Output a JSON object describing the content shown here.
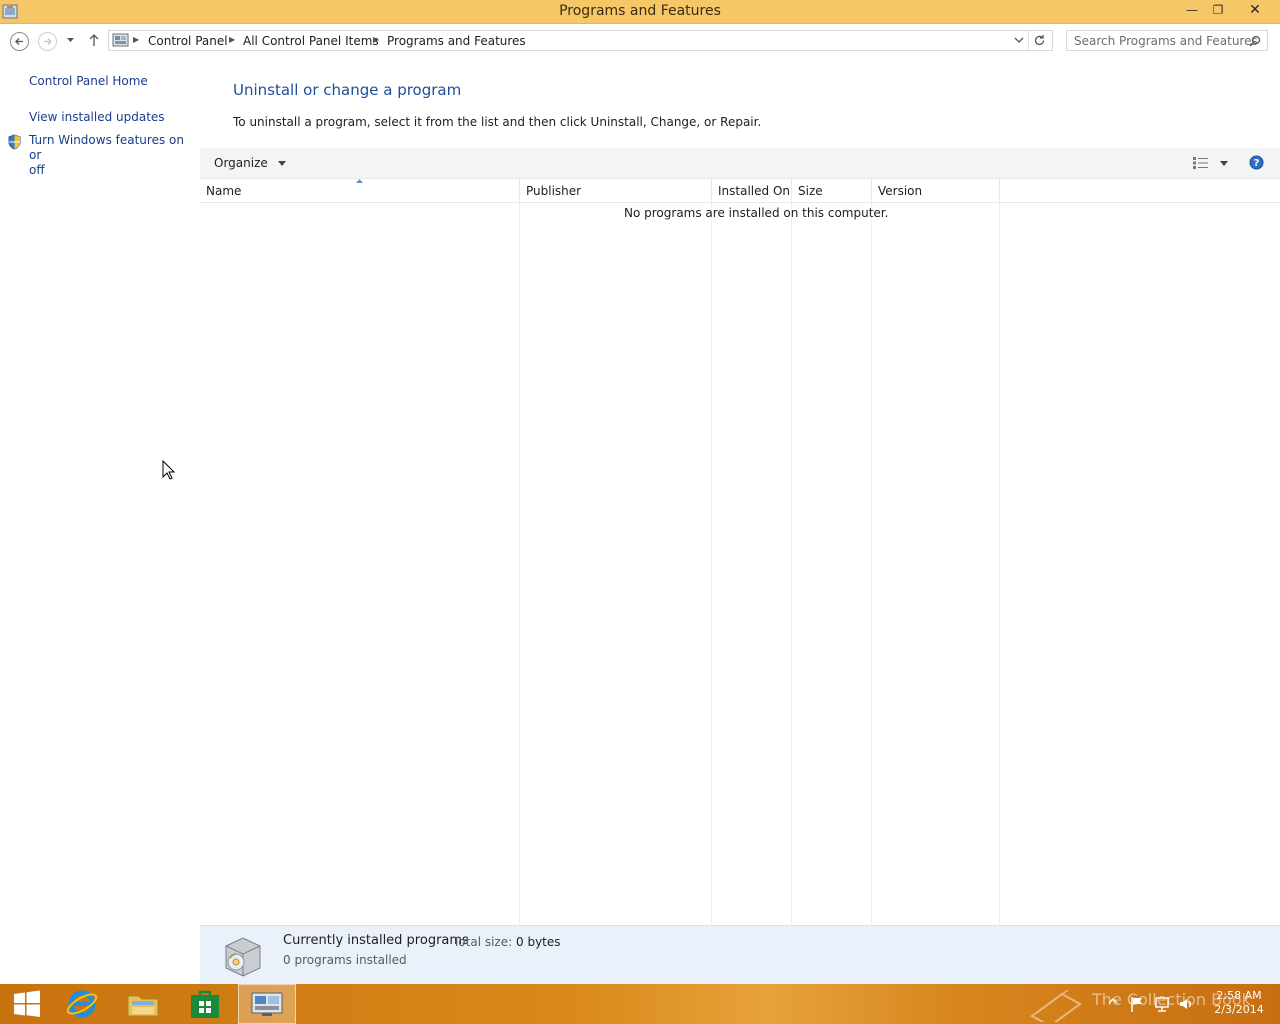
{
  "window": {
    "title": "Programs and Features",
    "controls": {
      "minimize": "—",
      "maximize": "❐",
      "close": "✕"
    }
  },
  "nav": {
    "breadcrumbs": [
      "Control Panel",
      "All Control Panel Items",
      "Programs and Features"
    ],
    "search_placeholder": "Search Programs and Features"
  },
  "sidebar": {
    "links": [
      {
        "label": "Control Panel Home"
      },
      {
        "label": "View installed updates"
      },
      {
        "label": "Turn Windows features on or off",
        "line1": "Turn Windows features on or",
        "line2": "off"
      }
    ]
  },
  "main": {
    "heading": "Uninstall or change a program",
    "instructions": "To uninstall a program, select it from the list and then click Uninstall, Change, or Repair.",
    "toolbar": {
      "organize": "Organize"
    },
    "columns": [
      "Name",
      "Publisher",
      "Installed On",
      "Size",
      "Version"
    ],
    "empty_message": "No programs are installed on this computer."
  },
  "details": {
    "title": "Currently installed programs",
    "total_size_label": "Total size:",
    "total_size_value": "0 bytes",
    "count": "0 programs installed"
  },
  "taskbar": {
    "items": [
      "start-icon",
      "internet-explorer-icon",
      "file-explorer-icon",
      "store-icon",
      "control-panel-icon"
    ],
    "watermark": "The Collection Book",
    "clock": {
      "time": "2:58 AM",
      "date": "2/3/2014"
    }
  },
  "colors": {
    "titlebar": "#f6c766",
    "link": "#1a3e8c",
    "heading": "#1f4e98",
    "details_bg": "#eaf1fb",
    "taskbar": "#d98a1a"
  }
}
